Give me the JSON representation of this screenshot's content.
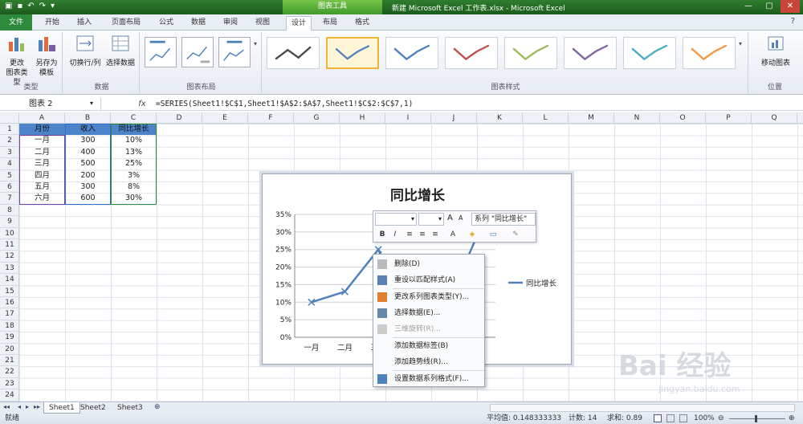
{
  "titlebar": {
    "tools_label": "图表工具",
    "window_title": "新建 Microsoft Excel 工作表.xlsx - Microsoft Excel",
    "min": "—",
    "max": "▢",
    "close": "✕"
  },
  "tabs": {
    "file": "文件",
    "home": "开始",
    "insert": "插入",
    "page_layout": "页面布局",
    "formulas": "公式",
    "data": "数据",
    "review": "审阅",
    "view": "视图",
    "design": "设计",
    "layout": "布局",
    "format": "格式"
  },
  "ribbon": {
    "change_type_1": "更改",
    "change_type_2": "图表类型",
    "save_template_1": "另存为",
    "save_template_2": "模板",
    "group_type": "类型",
    "switch_rowcol": "切换行/列",
    "select_data": "选择数据",
    "group_data": "数据",
    "group_layout": "图表布局",
    "group_style": "图表样式",
    "move_chart": "移动图表",
    "group_location": "位置",
    "style_colors": [
      "#4a4a4a",
      "#4f81bd",
      "#4f81bd",
      "#c0504d",
      "#9bbb59",
      "#8064a2",
      "#4bacc6",
      "#f79646"
    ]
  },
  "formula_bar": {
    "name_box": "图表 2",
    "fx": "fx",
    "formula": "=SERIES(Sheet1!$C$1,Sheet1!$A$2:$A$7,Sheet1!$C$2:$C$7,1)"
  },
  "columns": [
    "A",
    "B",
    "C",
    "D",
    "E",
    "F",
    "G",
    "H",
    "I",
    "J",
    "K",
    "L",
    "M",
    "N",
    "O",
    "P",
    "Q"
  ],
  "rows": [
    "1",
    "2",
    "3",
    "4",
    "5",
    "6",
    "7",
    "8",
    "9",
    "10",
    "11",
    "12",
    "13",
    "14",
    "15",
    "16",
    "17",
    "18",
    "19",
    "20",
    "21",
    "22",
    "23",
    "24"
  ],
  "table": {
    "headers": [
      "月份",
      "收入",
      "同比增长"
    ],
    "rows": [
      [
        "一月",
        "300",
        "10%"
      ],
      [
        "二月",
        "400",
        "13%"
      ],
      [
        "三月",
        "500",
        "25%"
      ],
      [
        "四月",
        "200",
        "3%"
      ],
      [
        "五月",
        "300",
        "8%"
      ],
      [
        "六月",
        "600",
        "30%"
      ]
    ]
  },
  "chart_data": {
    "type": "line",
    "title": "同比增长",
    "categories": [
      "一月",
      "二月",
      "三月",
      "四月",
      "五月",
      "六月"
    ],
    "series": [
      {
        "name": "同比增长",
        "values": [
          0.1,
          0.13,
          0.25,
          0.03,
          0.08,
          0.3
        ],
        "color": "#4f81bd"
      }
    ],
    "ylim": [
      0,
      0.35
    ],
    "y_ticks": [
      "0%",
      "5%",
      "10%",
      "15%",
      "20%",
      "25%",
      "30%",
      "35%"
    ],
    "grid": true,
    "legend_position": "right",
    "legend_label": "同比增长"
  },
  "mini_toolbar": {
    "series_label": "系列 \"同比增长\"",
    "bold": "B",
    "italic": "I",
    "font_grow": "A",
    "font_shrink": "A"
  },
  "context_menu": [
    {
      "label": "删除(D)",
      "icon": "delete-icon",
      "disabled": false
    },
    {
      "label": "重设以匹配样式(A)",
      "icon": "reset-style-icon",
      "disabled": false
    },
    {
      "label": "更改系列图表类型(Y)...",
      "icon": "chart-type-icon",
      "disabled": false
    },
    {
      "label": "选择数据(E)...",
      "icon": "select-data-icon",
      "disabled": false
    },
    {
      "label": "三维旋转(R)...",
      "icon": "rotate-3d-icon",
      "disabled": true
    },
    {
      "label": "添加数据标签(B)",
      "icon": "",
      "disabled": false
    },
    {
      "label": "添加趋势线(R)...",
      "icon": "",
      "disabled": false
    },
    {
      "label": "设置数据系列格式(F)...",
      "icon": "format-series-icon",
      "disabled": false
    }
  ],
  "sheets": [
    "Sheet1",
    "Sheet2",
    "Sheet3"
  ],
  "status": {
    "ready": "就绪",
    "average": "平均值: 0.148333333",
    "count": "计数: 14",
    "sum": "求和: 0.89",
    "zoom": "100%"
  },
  "watermark": {
    "line1": "Bai  经验",
    "line2": "jingyan.baidu.com"
  }
}
